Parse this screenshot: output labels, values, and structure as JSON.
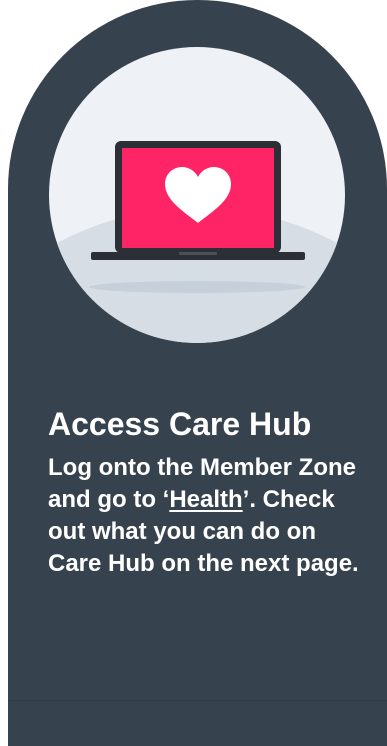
{
  "card": {
    "title": "Access Care Hub",
    "desc_part1": "Log onto the Member Zone and go to ‘",
    "desc_link": "Health",
    "desc_part2": "’. Check out what you can do on Care Hub on the next page."
  },
  "illustration": {
    "icon": "laptop-heart-icon",
    "screen_color": "#ff2466",
    "background_color": "#eef1f5"
  },
  "colors": {
    "card_background": "#37424f",
    "text": "#ffffff"
  }
}
